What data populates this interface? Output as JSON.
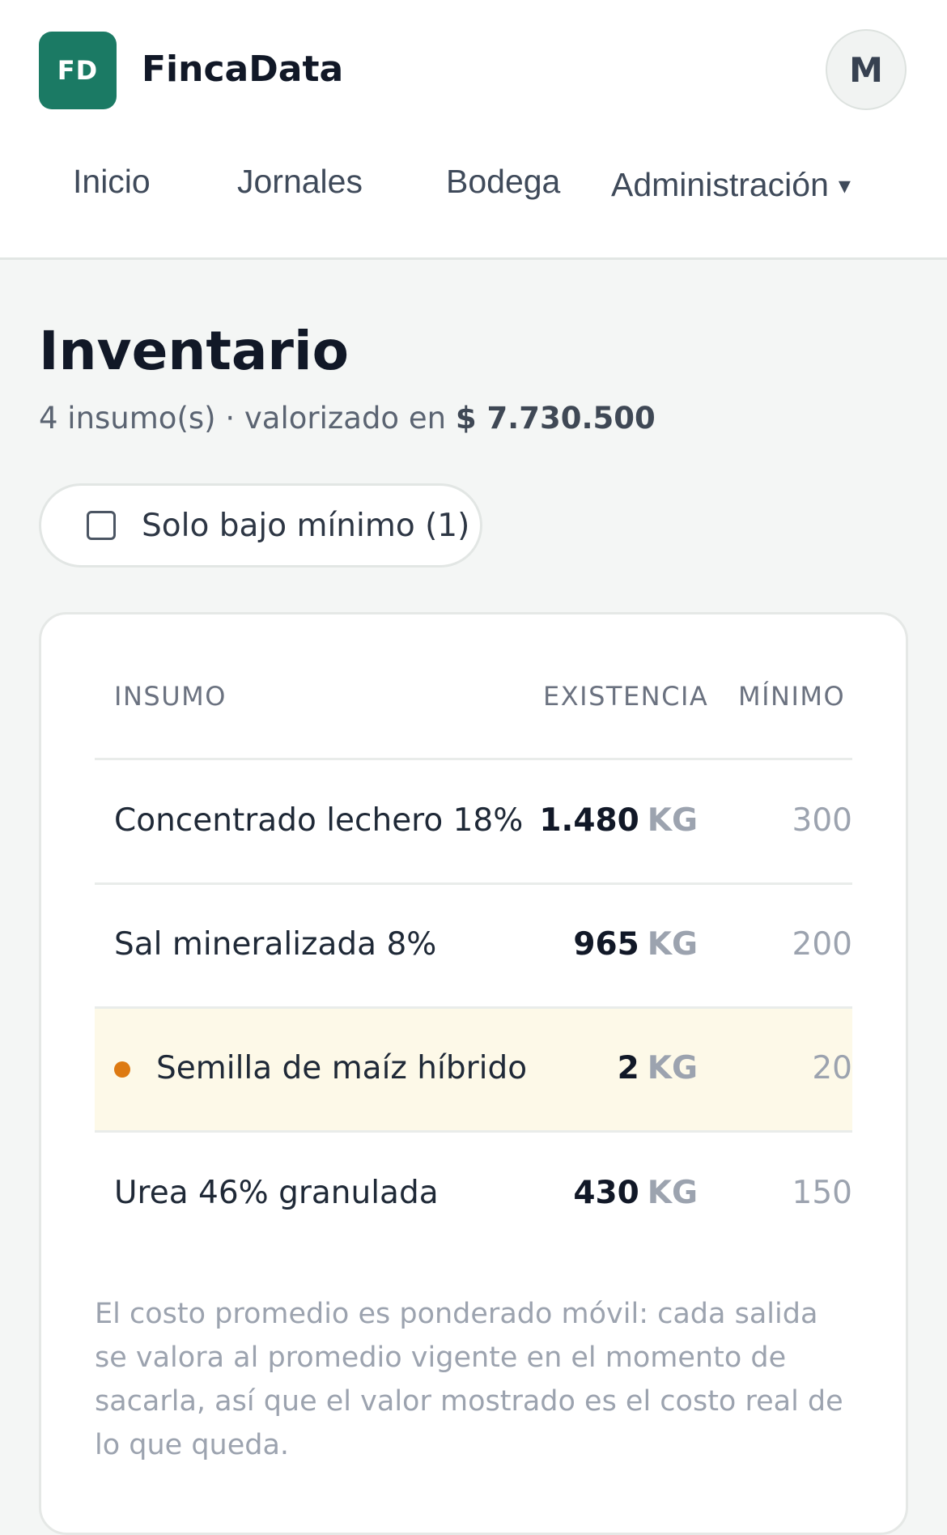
{
  "header": {
    "logo_text": "FD",
    "brand": "FincaData",
    "avatar_initial": "M",
    "nav": [
      {
        "label": "Inicio"
      },
      {
        "label": "Jornales"
      },
      {
        "label": "Bodega"
      },
      {
        "label": "Administración",
        "caret": "▾"
      }
    ]
  },
  "page": {
    "title": "Inventario",
    "subtitle_prefix": "4 insumo(s) · valorizado en ",
    "subtitle_value": "$ 7.730.500"
  },
  "filter": {
    "label": "Solo bajo mínimo (1)",
    "checked": false
  },
  "table": {
    "headers": [
      "INSUMO",
      "EXISTENCIA",
      "MÍNIMO"
    ],
    "rows": [
      {
        "name": "Concentrado lechero 18%",
        "stock": "1.480",
        "unit": "KG",
        "min": "300",
        "alert": false
      },
      {
        "name": "Sal mineralizada 8%",
        "stock": "965",
        "unit": "KG",
        "min": "200",
        "alert": false
      },
      {
        "name": "Semilla de maíz híbrido",
        "stock": "2",
        "unit": "KG",
        "min": "20",
        "alert": true
      },
      {
        "name": "Urea 46% granulada",
        "stock": "430",
        "unit": "KG",
        "min": "150",
        "alert": false
      }
    ],
    "footnote": "El costo promedio es ponderado móvil: cada salida se valora al promedio vigente en el momento de sacarla, así que el valor mostrado es el costo real de lo que queda."
  },
  "colors": {
    "brand": "#1b7a64",
    "alert_row_bg": "#fdf9e8",
    "alert_dot": "#dd7a12"
  }
}
